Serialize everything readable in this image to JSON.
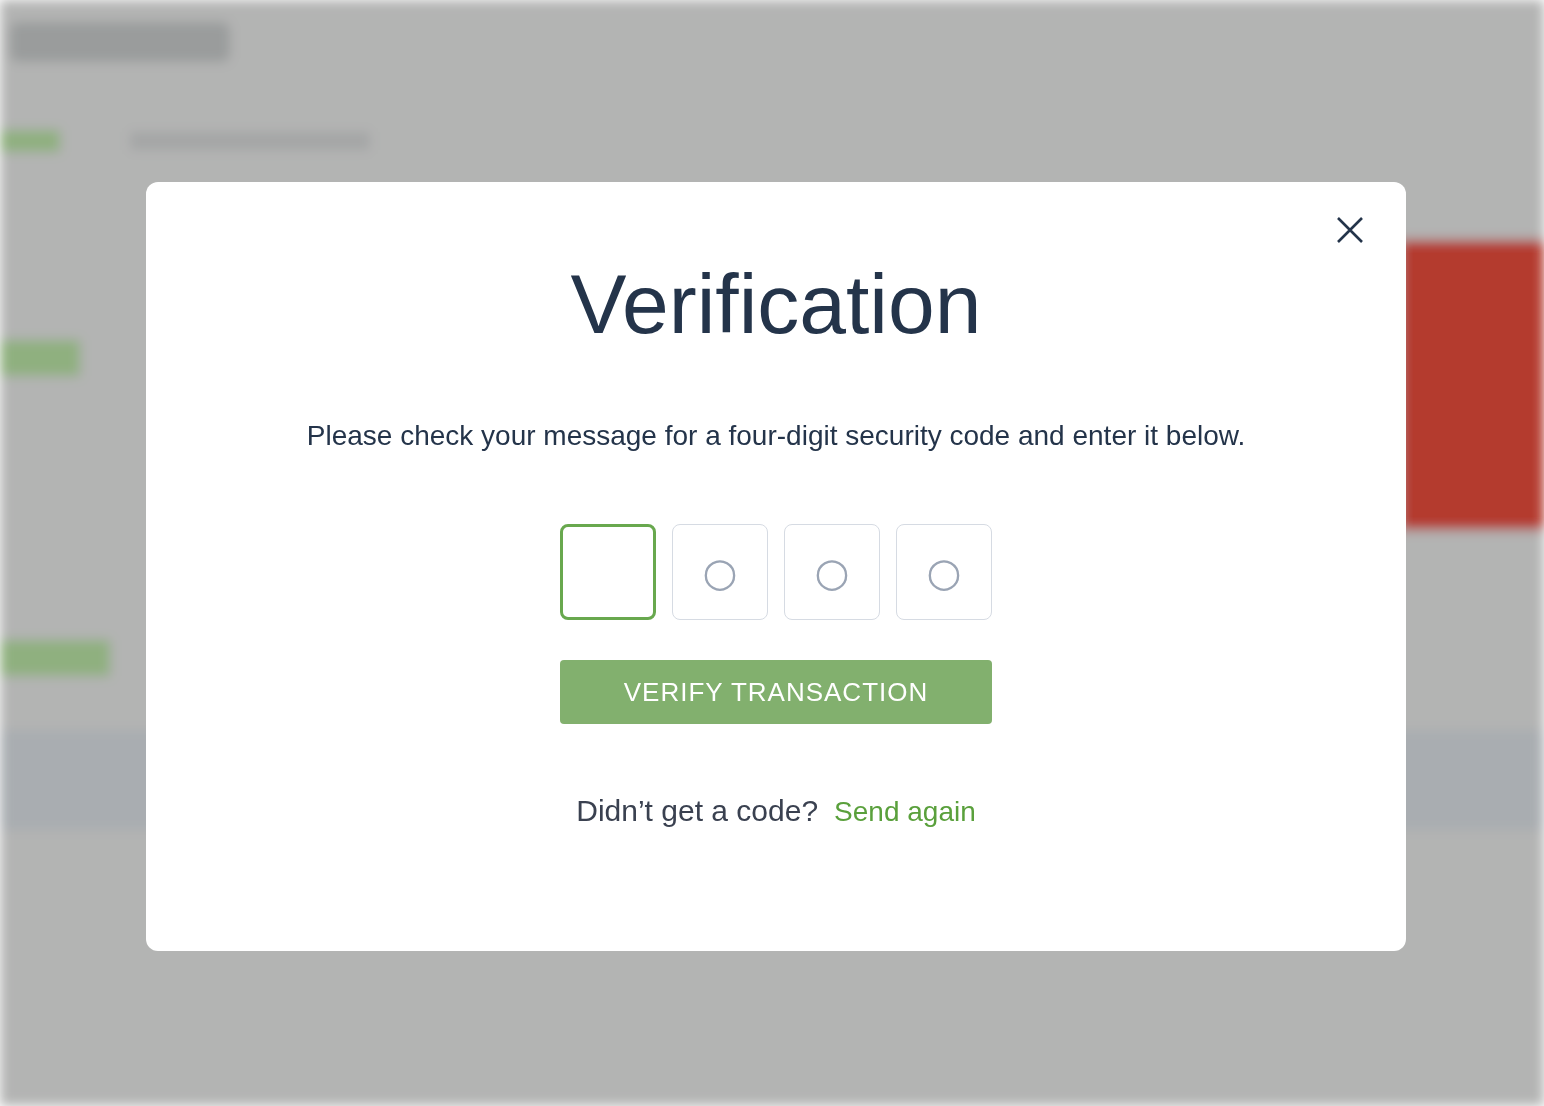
{
  "dialog": {
    "title": "Verification",
    "message": "Please check your message for a four-digit security code and enter it below.",
    "code_boxes": [
      {
        "focused": true
      },
      {
        "focused": false,
        "placeholder": "○"
      },
      {
        "focused": false,
        "placeholder": "○"
      },
      {
        "focused": false,
        "placeholder": "○"
      }
    ],
    "verify_button": "VERIFY TRANSACTION",
    "resend_prompt": "Didn’t get a code?",
    "resend_link": "Send again"
  }
}
